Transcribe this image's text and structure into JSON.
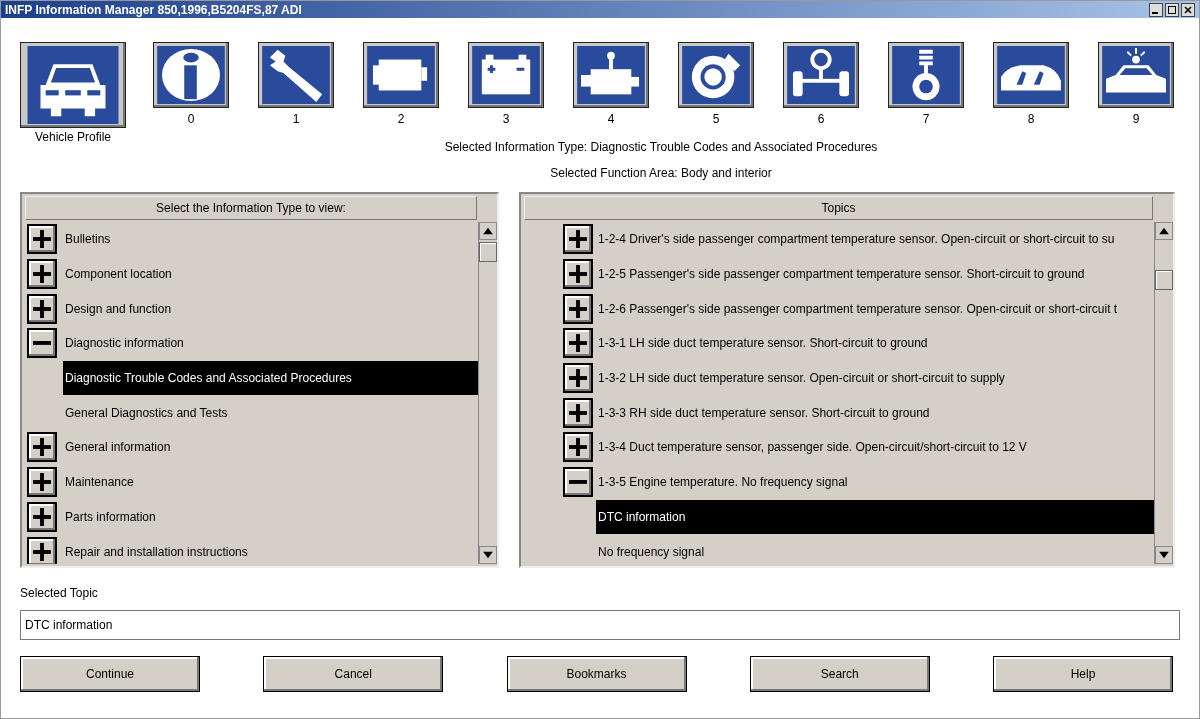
{
  "window": {
    "title": "INFP Information Manager 850,1996,B5204FS,87 ADI"
  },
  "toolbar": [
    {
      "label": "Vehicle Profile"
    },
    {
      "label": "0"
    },
    {
      "label": "1"
    },
    {
      "label": "2"
    },
    {
      "label": "3"
    },
    {
      "label": "4"
    },
    {
      "label": "5"
    },
    {
      "label": "6"
    },
    {
      "label": "7"
    },
    {
      "label": "8"
    },
    {
      "label": "9"
    }
  ],
  "selected_information_type": "Selected Information Type: Diagnostic Trouble Codes and Associated Procedures",
  "selected_function_area": "Selected Function Area: Body and interior",
  "information_types": {
    "header": "Select the Information Type to view:",
    "items": [
      {
        "label": "Bulletins",
        "expanded": false
      },
      {
        "label": "Component location",
        "expanded": false
      },
      {
        "label": "Design and function",
        "expanded": false
      },
      {
        "label": "Diagnostic information",
        "expanded": true,
        "children": [
          {
            "label": "Diagnostic Trouble Codes and Associated Procedures",
            "selected": true
          },
          {
            "label": "General Diagnostics and Tests",
            "selected": false
          }
        ]
      },
      {
        "label": "General information",
        "expanded": false
      },
      {
        "label": "Maintenance",
        "expanded": false
      },
      {
        "label": "Parts information",
        "expanded": false
      },
      {
        "label": "Repair and installation instructions",
        "expanded": false
      }
    ]
  },
  "topics": {
    "header": "Topics",
    "items": [
      {
        "label": "1-2-4 Driver's side passenger compartment temperature sensor. Open-circuit or short-circuit to su",
        "expanded": false
      },
      {
        "label": "1-2-5 Passenger's side passenger compartment temperature sensor. Short-circuit to ground",
        "expanded": false
      },
      {
        "label": "1-2-6 Passenger's side passenger compartment temperature sensor. Open-circuit or short-circuit t",
        "expanded": false
      },
      {
        "label": "1-3-1 LH side duct temperature sensor. Short-circuit to ground",
        "expanded": false
      },
      {
        "label": "1-3-2 LH side duct temperature sensor. Open-circuit or short-circuit to supply",
        "expanded": false
      },
      {
        "label": "1-3-3 RH side duct temperature sensor. Short-circuit to ground",
        "expanded": false
      },
      {
        "label": "1-3-4 Duct temperature sensor, passenger side. Open-circuit/short-circuit to 12 V",
        "expanded": false
      },
      {
        "label": "1-3-5 Engine temperature. No frequency signal",
        "expanded": true,
        "children": [
          {
            "label": "DTC information",
            "selected": true
          },
          {
            "label": "No frequency signal",
            "selected": false
          }
        ]
      }
    ]
  },
  "selected_topic": {
    "label": "Selected Topic",
    "value": "DTC information"
  },
  "buttons": [
    "Continue",
    "Cancel",
    "Bookmarks",
    "Search",
    "Help"
  ]
}
